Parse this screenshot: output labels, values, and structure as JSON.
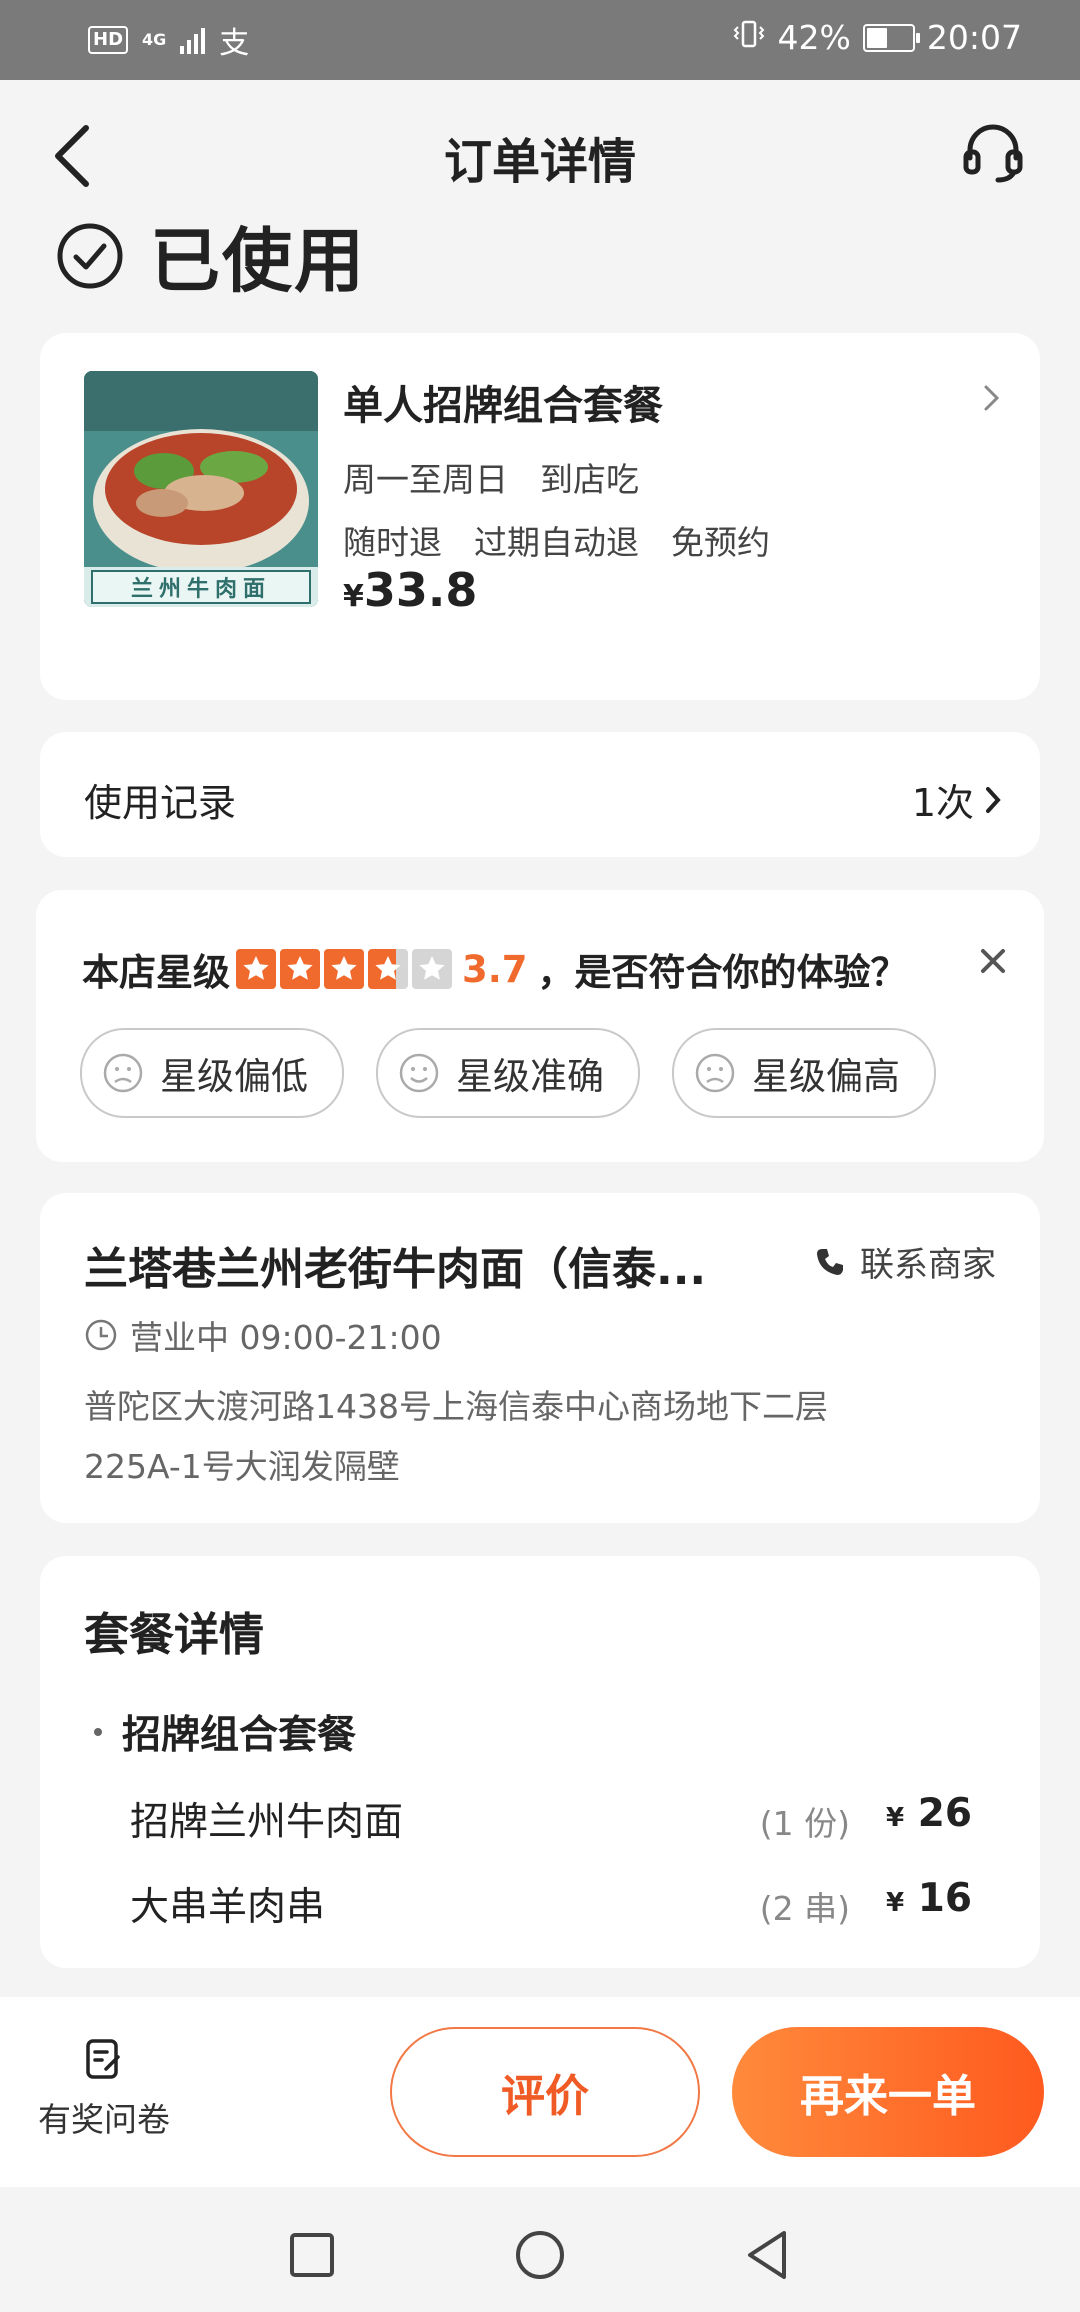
{
  "status_bar": {
    "network": "4G",
    "hd": "HD",
    "extra_icon": "支",
    "battery": "42%",
    "time": "20:07"
  },
  "header": {
    "title": "订单详情",
    "status": "已使用"
  },
  "product": {
    "name": "单人招牌组合套餐",
    "tags_line1": [
      "周一至周日",
      "到店吃"
    ],
    "tags_line2": [
      "随时退",
      "过期自动退",
      "免预约"
    ],
    "currency": "¥",
    "price": "33.8",
    "image_caption": "兰州牛肉面"
  },
  "usage": {
    "label": "使用记录",
    "count": "1次"
  },
  "rating": {
    "prefix": "本店星级",
    "score": "3.7",
    "question": "，是否符合你的体验？",
    "stars_value": 3.7,
    "options": [
      "星级偏低",
      "星级准确",
      "星级偏高"
    ]
  },
  "store": {
    "name": "兰塔巷兰州老街牛肉面（信泰...",
    "contact": "联系商家",
    "hours": "营业中 09:00-21:00",
    "address_line1": "普陀区大渡河路1438号上海信泰中心商场地下二层",
    "address_line2": "225A-1号大润发隔壁"
  },
  "package": {
    "title": "套餐详情",
    "group": "招牌组合套餐",
    "items": [
      {
        "name": "招牌兰州牛肉面",
        "qty": "(1 份)",
        "currency": "¥",
        "price": "26"
      },
      {
        "name": "大串羊肉串",
        "qty": "(2 串)",
        "currency": "¥",
        "price": "16"
      }
    ]
  },
  "actions": {
    "survey": "有奖问卷",
    "rate": "评价",
    "reorder": "再来一单"
  },
  "colors": {
    "accent": "#f05a24",
    "star": "#f06a2d"
  }
}
